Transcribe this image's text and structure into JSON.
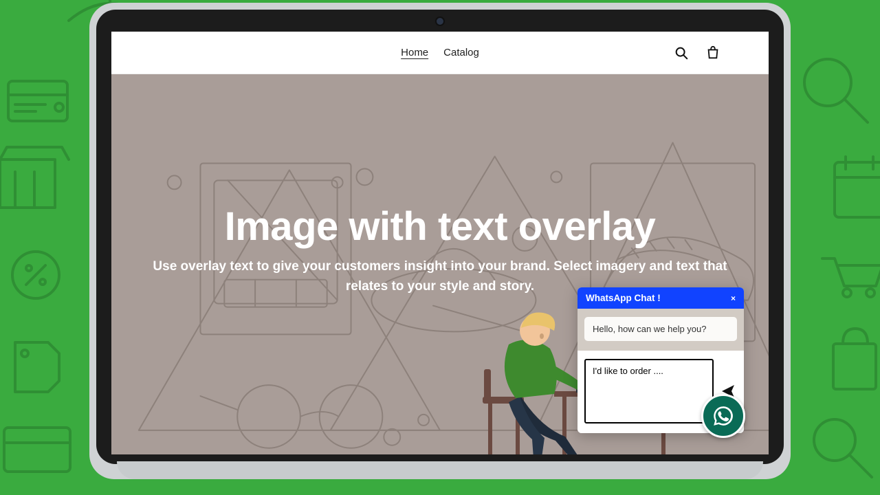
{
  "nav": {
    "home": "Home",
    "catalog": "Catalog"
  },
  "hero": {
    "title": "Image with text overlay",
    "subtitle": "Use overlay text to give your customers insight into your brand. Select imagery and text that relates to your style and story."
  },
  "chat": {
    "header": "WhatsApp Chat !",
    "close": "×",
    "greeting": "Hello, how can we help you?",
    "input_value": "I'd like to order ...."
  }
}
